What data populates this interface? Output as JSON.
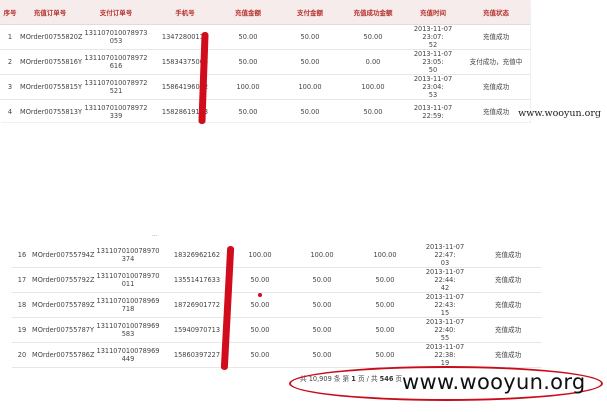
{
  "columns": [
    "序号",
    "充值订单号",
    "支付订单号",
    "手机号",
    "充值金额",
    "支付金额",
    "充值成功金额",
    "充值时间",
    "充值状态"
  ],
  "top_rows": [
    {
      "no": "1",
      "order": "MOrder00755820Z",
      "pay_1": "131107010078973",
      "pay_2": "053",
      "phone": "13472800115",
      "amount": "50.00",
      "paid": "50.00",
      "success": "50.00",
      "time_1": "2013-11-07 23:07:",
      "time_2": "52",
      "status": "充值成功"
    },
    {
      "no": "2",
      "order": "MOrder00755816Y",
      "pay_1": "131107010078972",
      "pay_2": "616",
      "phone": "15834375004",
      "amount": "50.00",
      "paid": "50.00",
      "success": "0.00",
      "time_1": "2013-11-07 23:05:",
      "time_2": "50",
      "status": "支付成功，充值中"
    },
    {
      "no": "3",
      "order": "MOrder00755815Y",
      "pay_1": "131107010078972",
      "pay_2": "521",
      "phone": "15864196092",
      "amount": "100.00",
      "paid": "100.00",
      "success": "100.00",
      "time_1": "2013-11-07 23:04:",
      "time_2": "53",
      "status": "充值成功"
    },
    {
      "no": "4",
      "order": "MOrder00755813Y",
      "pay_1": "131107010078972",
      "pay_2": "339",
      "phone": "15828619153",
      "amount": "50.00",
      "paid": "50.00",
      "success": "50.00",
      "time_1": "2013-11-07 22:59:",
      "time_2": "",
      "status": "充值成功"
    }
  ],
  "bottom_rows": [
    {
      "no": "16",
      "order": "MOrder00755794Z",
      "pay_1": "131107010078970",
      "pay_2": "374",
      "phone": "18326962162",
      "amount": "100.00",
      "paid": "100.00",
      "success": "100.00",
      "time_1": "2013-11-07 22:47:",
      "time_2": "03",
      "status": "充值成功"
    },
    {
      "no": "17",
      "order": "MOrder00755792Z",
      "pay_1": "131107010078970",
      "pay_2": "011",
      "phone": "13551417633",
      "amount": "50.00",
      "paid": "50.00",
      "success": "50.00",
      "time_1": "2013-11-07 22:44:",
      "time_2": "42",
      "status": "充值成功"
    },
    {
      "no": "18",
      "order": "MOrder00755789Z",
      "pay_1": "131107010078969",
      "pay_2": "718",
      "phone": "18726901772",
      "amount": "50.00",
      "paid": "50.00",
      "success": "50.00",
      "time_1": "2013-11-07 22:43:",
      "time_2": "15",
      "status": "充值成功"
    },
    {
      "no": "19",
      "order": "MOrder00755787Y",
      "pay_1": "131107010078969",
      "pay_2": "583",
      "phone": "15940970713",
      "amount": "50.00",
      "paid": "50.00",
      "success": "50.00",
      "time_1": "2013-11-07 22:40:",
      "time_2": "55",
      "status": "充值成功"
    },
    {
      "no": "20",
      "order": "MOrder00755786Z",
      "pay_1": "131107010078969",
      "pay_2": "449",
      "phone": "15860397227",
      "amount": "50.00",
      "paid": "50.00",
      "success": "50.00",
      "time_1": "2013-11-07 22:38:",
      "time_2": "19",
      "status": "充值成功"
    }
  ],
  "pager": {
    "prefix": "共 10,909 条  第 ",
    "page": "1",
    "middle": " 页 / 共 ",
    "total": "546",
    "suffix": " 页"
  },
  "watermarks": {
    "small": "www.wooyun.org",
    "large": "www.wooyun.org"
  },
  "colors": {
    "header_text": "#b4322e",
    "redaction": "#d10c1c"
  }
}
